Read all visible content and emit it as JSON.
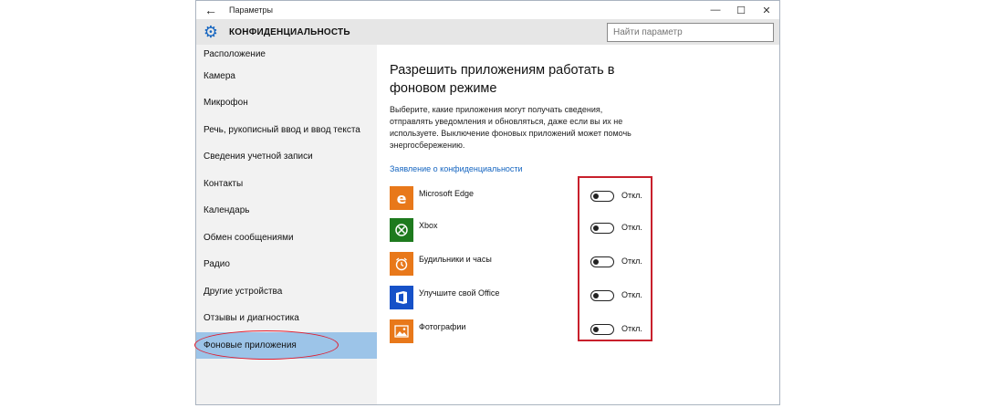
{
  "window": {
    "title": "Параметры",
    "back_glyph": "←",
    "minimize_glyph": "—",
    "maximize_glyph": "☐",
    "close_glyph": "✕"
  },
  "header": {
    "section_title": "КОНФИДЕНЦИАЛЬНОСТЬ",
    "gear_glyph": "⚙",
    "search_placeholder": "Найти параметр"
  },
  "sidebar": {
    "items": [
      {
        "label": "Расположение",
        "active": false
      },
      {
        "label": "Камера",
        "active": false
      },
      {
        "label": "Микрофон",
        "active": false
      },
      {
        "label": "Речь, рукописный ввод и ввод текста",
        "active": false
      },
      {
        "label": "Сведения учетной записи",
        "active": false
      },
      {
        "label": "Контакты",
        "active": false
      },
      {
        "label": "Календарь",
        "active": false
      },
      {
        "label": "Обмен сообщениями",
        "active": false
      },
      {
        "label": "Радио",
        "active": false
      },
      {
        "label": "Другие устройства",
        "active": false
      },
      {
        "label": "Отзывы и диагностика",
        "active": false
      },
      {
        "label": "Фоновые приложения",
        "active": true
      }
    ]
  },
  "main": {
    "heading": "Разрешить приложениям работать в фоновом режиме",
    "description": "Выберите, какие приложения могут получать сведения, отправлять уведомления и обновляться, даже если вы их не используете. Выключение фоновых приложений может помочь энергосбережению.",
    "privacy_link": "Заявление о конфиденциальности",
    "apps": [
      {
        "name": "Microsoft Edge",
        "icon": "edge-icon",
        "icon_glyph": "e",
        "icon_color": "#e8781a",
        "state": "Откл."
      },
      {
        "name": "Xbox",
        "icon": "xbox-icon",
        "icon_glyph": "✕",
        "icon_color": "#1e7a1e",
        "state": "Откл."
      },
      {
        "name": "Будильники и часы",
        "icon": "alarm-clock-icon",
        "icon_glyph": "⏰",
        "icon_color": "#e8781a",
        "state": "Откл."
      },
      {
        "name": "Улучшите свой Office",
        "icon": "office-icon",
        "icon_glyph": "◧",
        "icon_color": "#1651c8",
        "state": "Откл."
      },
      {
        "name": "Фотографии",
        "icon": "photos-icon",
        "icon_glyph": "▲",
        "icon_color": "#e8781a",
        "state": "Откл."
      }
    ]
  }
}
